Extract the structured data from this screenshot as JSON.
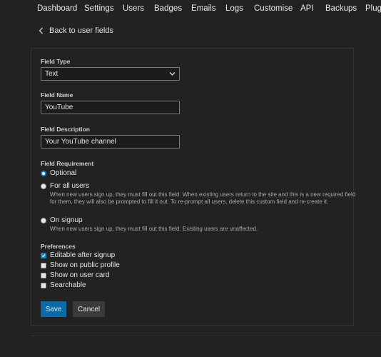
{
  "nav": [
    "Dashboard",
    "Settings",
    "Users",
    "Badges",
    "Emails",
    "Logs",
    "Customise",
    "API",
    "Backups",
    "Plugi"
  ],
  "back_link": "Back to user fields",
  "field_type": {
    "label": "Field Type",
    "value": "Text"
  },
  "field_name": {
    "label": "Field Name",
    "value": "YouTube"
  },
  "field_description": {
    "label": "Field Description",
    "value": "Your YouTube channel"
  },
  "requirement": {
    "label": "Field Requirement",
    "options": [
      {
        "title": "Optional",
        "desc": "",
        "selected": true
      },
      {
        "title": "For all users",
        "desc": "When new users sign up, they must fill out this field. When existing users return to the site and this is a new required field for them, they will also be prompted to fill it out. To re-prompt all users, delete this custom field and re-create it.",
        "selected": false
      },
      {
        "title": "On signup",
        "desc": "When new users sign up, they must fill out this field. Existing users are unaffected.",
        "selected": false
      }
    ]
  },
  "preferences": {
    "label": "Preferences",
    "items": [
      {
        "label": "Editable after signup",
        "checked": true
      },
      {
        "label": "Show on public profile",
        "checked": false
      },
      {
        "label": "Show on user card",
        "checked": false
      },
      {
        "label": "Searchable",
        "checked": false
      }
    ]
  },
  "buttons": {
    "save": "Save",
    "cancel": "Cancel"
  },
  "colors": {
    "accent": "#0b6aa5",
    "background": "#222222"
  }
}
